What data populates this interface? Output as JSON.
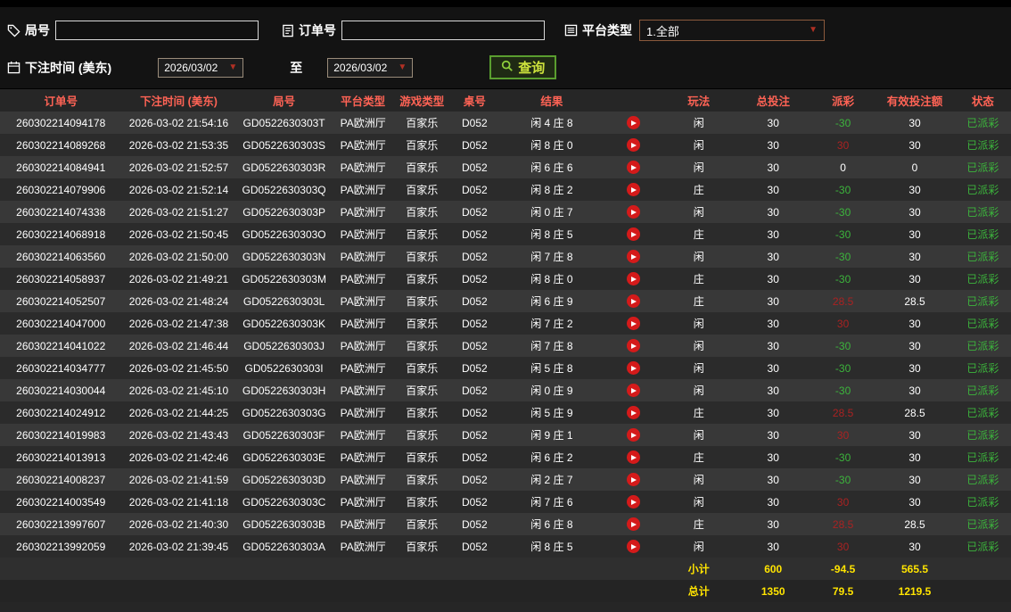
{
  "filters": {
    "round": {
      "label": "局号",
      "value": ""
    },
    "order": {
      "label": "订单号",
      "value": ""
    },
    "platform": {
      "label": "平台类型",
      "value": "1.全部"
    },
    "bet_time": {
      "label": "下注时间 (美东)",
      "from": "2026/03/02",
      "to_label": "至",
      "to": "2026/03/02"
    },
    "query_label": "查询"
  },
  "colors": {
    "header_text": "#ff6355",
    "win": "#aa2222",
    "loss": "#3cb43c",
    "status": "#3cb43c",
    "summary": "#ffe400",
    "accent_green": "#6fae35"
  },
  "table": {
    "headers": {
      "order_no": "订单号",
      "bet_time": "下注时间 (美东)",
      "round_no": "局号",
      "platform": "平台类型",
      "game_type": "游戏类型",
      "table_no": "桌号",
      "result": "结果",
      "replay": "",
      "play": "玩法",
      "total_bet": "总投注",
      "payout": "派彩",
      "valid_bet": "有效投注额",
      "status": "状态"
    },
    "rows": [
      {
        "order_no": "260302214094178",
        "bet_time": "2026-03-02 21:54:16",
        "round_no": "GD0522630303T",
        "platform": "PA欧洲厅",
        "game_type": "百家乐",
        "table_no": "D052",
        "result": "闲 4 庄 8",
        "play": "闲",
        "total_bet": "30",
        "payout": "-30",
        "payout_color": "loss",
        "valid_bet": "30",
        "status": "已派彩"
      },
      {
        "order_no": "260302214089268",
        "bet_time": "2026-03-02 21:53:35",
        "round_no": "GD0522630303S",
        "platform": "PA欧洲厅",
        "game_type": "百家乐",
        "table_no": "D052",
        "result": "闲 8 庄 0",
        "play": "闲",
        "total_bet": "30",
        "payout": "30",
        "payout_color": "win",
        "valid_bet": "30",
        "status": "已派彩"
      },
      {
        "order_no": "260302214084941",
        "bet_time": "2026-03-02 21:52:57",
        "round_no": "GD0522630303R",
        "platform": "PA欧洲厅",
        "game_type": "百家乐",
        "table_no": "D052",
        "result": "闲 6 庄 6",
        "play": "闲",
        "total_bet": "30",
        "payout": "0",
        "payout_color": "zero",
        "valid_bet": "0",
        "status": "已派彩"
      },
      {
        "order_no": "260302214079906",
        "bet_time": "2026-03-02 21:52:14",
        "round_no": "GD0522630303Q",
        "platform": "PA欧洲厅",
        "game_type": "百家乐",
        "table_no": "D052",
        "result": "闲 8 庄 2",
        "play": "庄",
        "total_bet": "30",
        "payout": "-30",
        "payout_color": "loss",
        "valid_bet": "30",
        "status": "已派彩"
      },
      {
        "order_no": "260302214074338",
        "bet_time": "2026-03-02 21:51:27",
        "round_no": "GD0522630303P",
        "platform": "PA欧洲厅",
        "game_type": "百家乐",
        "table_no": "D052",
        "result": "闲 0 庄 7",
        "play": "闲",
        "total_bet": "30",
        "payout": "-30",
        "payout_color": "loss",
        "valid_bet": "30",
        "status": "已派彩"
      },
      {
        "order_no": "260302214068918",
        "bet_time": "2026-03-02 21:50:45",
        "round_no": "GD0522630303O",
        "platform": "PA欧洲厅",
        "game_type": "百家乐",
        "table_no": "D052",
        "result": "闲 8 庄 5",
        "play": "庄",
        "total_bet": "30",
        "payout": "-30",
        "payout_color": "loss",
        "valid_bet": "30",
        "status": "已派彩"
      },
      {
        "order_no": "260302214063560",
        "bet_time": "2026-03-02 21:50:00",
        "round_no": "GD0522630303N",
        "platform": "PA欧洲厅",
        "game_type": "百家乐",
        "table_no": "D052",
        "result": "闲 7 庄 8",
        "play": "闲",
        "total_bet": "30",
        "payout": "-30",
        "payout_color": "loss",
        "valid_bet": "30",
        "status": "已派彩"
      },
      {
        "order_no": "260302214058937",
        "bet_time": "2026-03-02 21:49:21",
        "round_no": "GD0522630303M",
        "platform": "PA欧洲厅",
        "game_type": "百家乐",
        "table_no": "D052",
        "result": "闲 8 庄 0",
        "play": "庄",
        "total_bet": "30",
        "payout": "-30",
        "payout_color": "loss",
        "valid_bet": "30",
        "status": "已派彩"
      },
      {
        "order_no": "260302214052507",
        "bet_time": "2026-03-02 21:48:24",
        "round_no": "GD0522630303L",
        "platform": "PA欧洲厅",
        "game_type": "百家乐",
        "table_no": "D052",
        "result": "闲 6 庄 9",
        "play": "庄",
        "total_bet": "30",
        "payout": "28.5",
        "payout_color": "win",
        "valid_bet": "28.5",
        "status": "已派彩"
      },
      {
        "order_no": "260302214047000",
        "bet_time": "2026-03-02 21:47:38",
        "round_no": "GD0522630303K",
        "platform": "PA欧洲厅",
        "game_type": "百家乐",
        "table_no": "D052",
        "result": "闲 7 庄 2",
        "play": "闲",
        "total_bet": "30",
        "payout": "30",
        "payout_color": "win",
        "valid_bet": "30",
        "status": "已派彩"
      },
      {
        "order_no": "260302214041022",
        "bet_time": "2026-03-02 21:46:44",
        "round_no": "GD0522630303J",
        "platform": "PA欧洲厅",
        "game_type": "百家乐",
        "table_no": "D052",
        "result": "闲 7 庄 8",
        "play": "闲",
        "total_bet": "30",
        "payout": "-30",
        "payout_color": "loss",
        "valid_bet": "30",
        "status": "已派彩"
      },
      {
        "order_no": "260302214034777",
        "bet_time": "2026-03-02 21:45:50",
        "round_no": "GD0522630303I",
        "platform": "PA欧洲厅",
        "game_type": "百家乐",
        "table_no": "D052",
        "result": "闲 5 庄 8",
        "play": "闲",
        "total_bet": "30",
        "payout": "-30",
        "payout_color": "loss",
        "valid_bet": "30",
        "status": "已派彩"
      },
      {
        "order_no": "260302214030044",
        "bet_time": "2026-03-02 21:45:10",
        "round_no": "GD0522630303H",
        "platform": "PA欧洲厅",
        "game_type": "百家乐",
        "table_no": "D052",
        "result": "闲 0 庄 9",
        "play": "闲",
        "total_bet": "30",
        "payout": "-30",
        "payout_color": "loss",
        "valid_bet": "30",
        "status": "已派彩"
      },
      {
        "order_no": "260302214024912",
        "bet_time": "2026-03-02 21:44:25",
        "round_no": "GD0522630303G",
        "platform": "PA欧洲厅",
        "game_type": "百家乐",
        "table_no": "D052",
        "result": "闲 5 庄 9",
        "play": "庄",
        "total_bet": "30",
        "payout": "28.5",
        "payout_color": "win",
        "valid_bet": "28.5",
        "status": "已派彩"
      },
      {
        "order_no": "260302214019983",
        "bet_time": "2026-03-02 21:43:43",
        "round_no": "GD0522630303F",
        "platform": "PA欧洲厅",
        "game_type": "百家乐",
        "table_no": "D052",
        "result": "闲 9 庄 1",
        "play": "闲",
        "total_bet": "30",
        "payout": "30",
        "payout_color": "win",
        "valid_bet": "30",
        "status": "已派彩"
      },
      {
        "order_no": "260302214013913",
        "bet_time": "2026-03-02 21:42:46",
        "round_no": "GD0522630303E",
        "platform": "PA欧洲厅",
        "game_type": "百家乐",
        "table_no": "D052",
        "result": "闲 6 庄 2",
        "play": "庄",
        "total_bet": "30",
        "payout": "-30",
        "payout_color": "loss",
        "valid_bet": "30",
        "status": "已派彩"
      },
      {
        "order_no": "260302214008237",
        "bet_time": "2026-03-02 21:41:59",
        "round_no": "GD0522630303D",
        "platform": "PA欧洲厅",
        "game_type": "百家乐",
        "table_no": "D052",
        "result": "闲 2 庄 7",
        "play": "闲",
        "total_bet": "30",
        "payout": "-30",
        "payout_color": "loss",
        "valid_bet": "30",
        "status": "已派彩"
      },
      {
        "order_no": "260302214003549",
        "bet_time": "2026-03-02 21:41:18",
        "round_no": "GD0522630303C",
        "platform": "PA欧洲厅",
        "game_type": "百家乐",
        "table_no": "D052",
        "result": "闲 7 庄 6",
        "play": "闲",
        "total_bet": "30",
        "payout": "30",
        "payout_color": "win",
        "valid_bet": "30",
        "status": "已派彩"
      },
      {
        "order_no": "260302213997607",
        "bet_time": "2026-03-02 21:40:30",
        "round_no": "GD0522630303B",
        "platform": "PA欧洲厅",
        "game_type": "百家乐",
        "table_no": "D052",
        "result": "闲 6 庄 8",
        "play": "庄",
        "total_bet": "30",
        "payout": "28.5",
        "payout_color": "win",
        "valid_bet": "28.5",
        "status": "已派彩"
      },
      {
        "order_no": "260302213992059",
        "bet_time": "2026-03-02 21:39:45",
        "round_no": "GD0522630303A",
        "platform": "PA欧洲厅",
        "game_type": "百家乐",
        "table_no": "D052",
        "result": "闲 8 庄 5",
        "play": "闲",
        "total_bet": "30",
        "payout": "30",
        "payout_color": "win",
        "valid_bet": "30",
        "status": "已派彩"
      }
    ],
    "summary": {
      "subtotal": {
        "label": "小计",
        "total_bet": "600",
        "payout": "-94.5",
        "valid_bet": "565.5"
      },
      "total": {
        "label": "总计",
        "total_bet": "1350",
        "payout": "79.5",
        "valid_bet": "1219.5"
      }
    }
  }
}
